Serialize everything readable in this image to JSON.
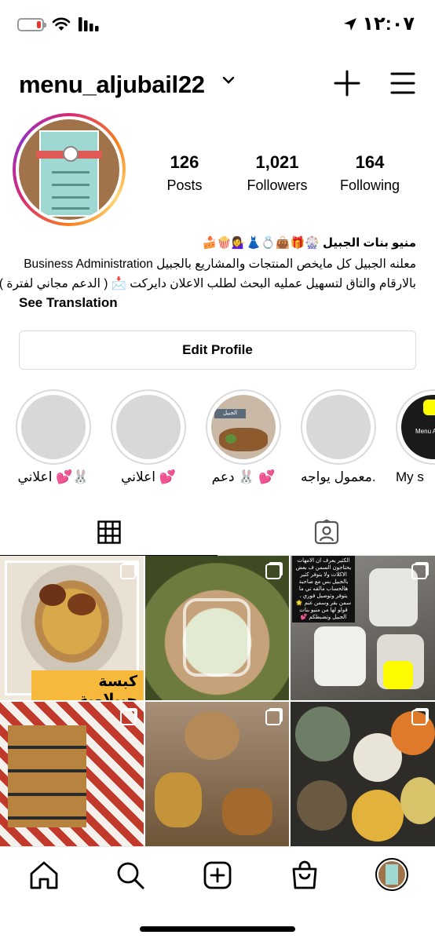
{
  "status_bar": {
    "time": "١٢:٠٧",
    "battery_level": 0.2
  },
  "header": {
    "username": "menu_aljubail22"
  },
  "profile": {
    "stats": [
      {
        "value": "126",
        "label": "Posts"
      },
      {
        "value": "1,021",
        "label": "Followers"
      },
      {
        "value": "164",
        "label": "Following"
      }
    ],
    "bio": {
      "name": "منيو بنات الجبيل 🎡🎁👜💍👗💁‍♀️🍿🍰",
      "line1": "معلنه الجبيل كل مايخص المنتجات والمشاريع بالجبيل Business Administration",
      "line2": "بالارقام والتاق لتسهيل عمليه البحث لطلب الاعلان دايركت 📩 ( الدعم مجاني لفترة )",
      "see_translation": "See Translation"
    },
    "edit_profile_label": "Edit Profile"
  },
  "highlights": [
    {
      "label": "اعلاني 💕🐰"
    },
    {
      "label": "اعلاني 💕"
    },
    {
      "label": "دعم 🐰 💕"
    },
    {
      "label": "معمول يواجه..."
    },
    {
      "label": "My s"
    }
  ],
  "highlight_thumb_texts": {
    "story3_tag": "الجبيل",
    "story5_title": "Menu Al"
  },
  "posts": [
    {
      "overlay_text": "كبسة جبيلاوية"
    },
    {
      "overlay_text": ""
    },
    {
      "overlay_text": "الكثير يعرف ان الامهات يحتاجون السمن ف بعض الاكلات ولا يتوفر كثير بالجبيل بس مع صاحبة هالحساب مالقه ني ما يتوفر وتوصيل فوري ، سمن بقر وسمن غنم 🌟 قولو لها من منيو بنات الجبيل وتضبطكم 💕"
    },
    {
      "overlay_text": ""
    },
    {
      "overlay_text": ""
    },
    {
      "overlay_text": ""
    }
  ],
  "colors": {
    "accent_pink": "#d62976",
    "border": "#dbdbdb",
    "battery_red": "#e8392f"
  },
  "icons": {
    "header": [
      "chevron-down-icon",
      "plus-icon",
      "hamburger-menu-icon"
    ],
    "tabs": [
      "grid-icon",
      "tagged-user-icon"
    ],
    "nav": [
      "home-icon",
      "search-icon",
      "add-post-icon",
      "shop-bag-icon",
      "profile-avatar"
    ]
  }
}
